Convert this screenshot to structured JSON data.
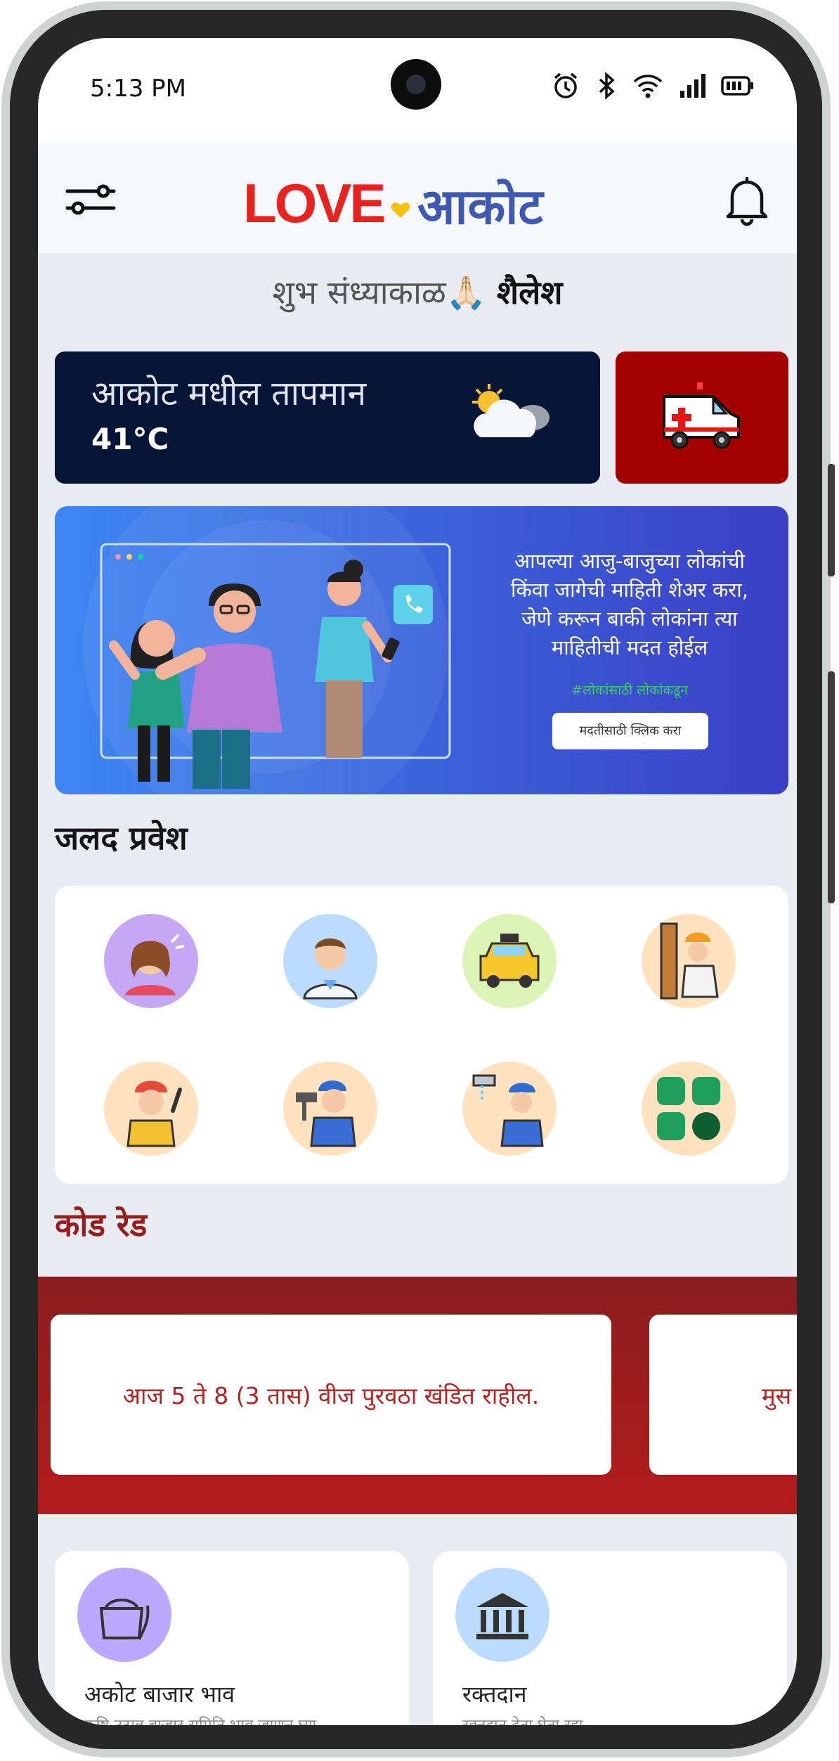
{
  "status_bar": {
    "time": "5:13 PM"
  },
  "header": {
    "logo_love": "LOVE",
    "logo_place": "आकोट"
  },
  "greeting": {
    "text": "शुभ संध्याकाळ",
    "emoji": "🙏🏻",
    "name": "शैलेश"
  },
  "weather": {
    "label": "आकोट मधील तापमान",
    "temperature": "41°C"
  },
  "banner": {
    "line1": "आपल्या आजु-बाजुच्या लोकांची",
    "line2": "किंवा जागेची माहिती शेअर करा,",
    "line3": "जेणे करून बाकी लोकांना त्या",
    "line4": "माहितीची मदत होईल",
    "hashtag": "#लोकांसाठी लोकांकडून",
    "button_label": "मदतीसाठी क्लिक करा"
  },
  "quick_access": {
    "title": "जलद प्रवेश",
    "items": [
      {
        "icon": "beautician-icon",
        "color": "#c4a8f5"
      },
      {
        "icon": "doctor-icon",
        "color": "#bcdcff"
      },
      {
        "icon": "taxi-icon",
        "color": "#dcf5b7"
      },
      {
        "icon": "carpenter-icon",
        "color": "#ffe2bf"
      },
      {
        "icon": "electrician-icon",
        "color": "#ffe2bf"
      },
      {
        "icon": "painter-icon",
        "color": "#ffe2bf"
      },
      {
        "icon": "plumber-icon",
        "color": "#ffe2bf"
      },
      {
        "icon": "more-apps-icon",
        "color": "#ffe2bf"
      }
    ]
  },
  "code_red": {
    "title": "कोड रेड",
    "alerts": [
      {
        "text": "आज 5 ते 8 (3 तास) वीज पुरवठा खंडित राहील."
      },
      {
        "text": "मुस"
      }
    ]
  },
  "tiles": [
    {
      "title": "अकोट बाजार भाव",
      "subtitle": "कृषि उत्पन्न बाजार समिति भाव जाणून घ्या",
      "icon": "market-icon",
      "color": "#b9a9ff"
    },
    {
      "title": "रक्तदान",
      "subtitle": "रक्तदान देता घेता रहा",
      "icon": "bank-building-icon",
      "color": "#bcdcff"
    }
  ],
  "colors": {
    "accent_red": "#a50000",
    "dark_navy": "#041537",
    "logo_red": "#e8231f",
    "logo_blue": "#3d59b4"
  }
}
